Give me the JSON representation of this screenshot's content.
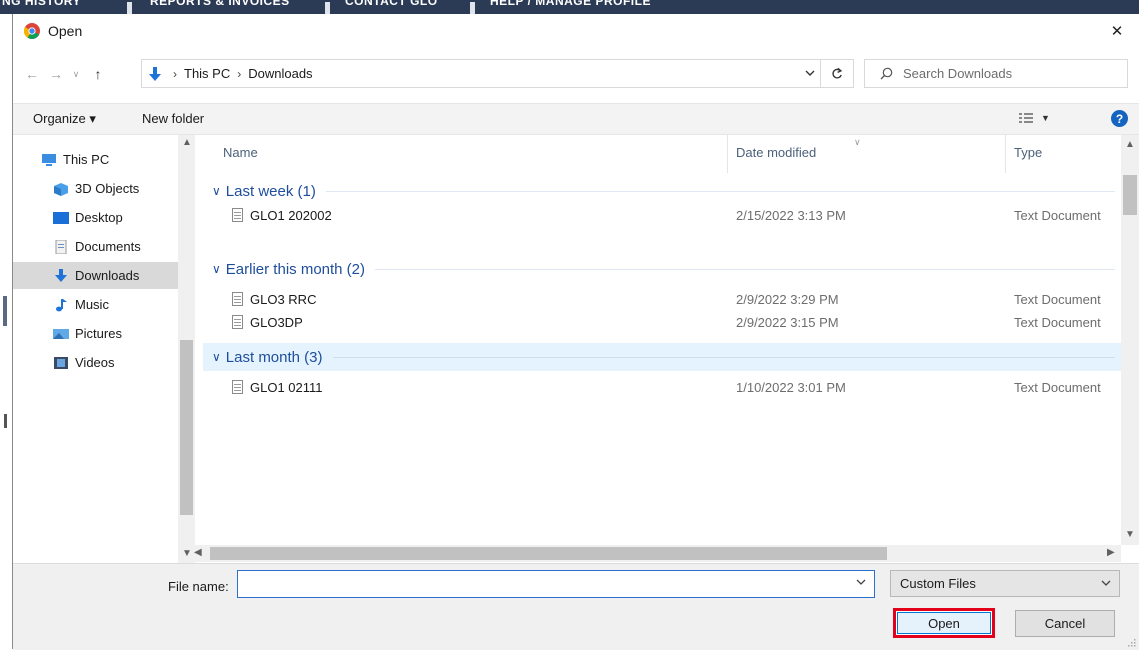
{
  "background_page": {
    "tabs": [
      "NG HISTORY",
      "REPORTS & INVOICES",
      "CONTACT GLO",
      "HELP / MANAGE PROFILE"
    ]
  },
  "window": {
    "title": "Open",
    "close_glyph": "✕"
  },
  "address": {
    "crumbs": [
      "This PC",
      "Downloads"
    ],
    "search_placeholder": "Search Downloads"
  },
  "toolbar": {
    "organize": "Organize ▾",
    "new_folder": "New folder",
    "help": "?"
  },
  "nav": {
    "items": [
      {
        "label": "This PC",
        "icon": "pc-icon"
      },
      {
        "label": "3D Objects",
        "icon": "cube-icon"
      },
      {
        "label": "Desktop",
        "icon": "desktop-icon"
      },
      {
        "label": "Documents",
        "icon": "documents-icon"
      },
      {
        "label": "Downloads",
        "icon": "download-icon",
        "selected": true
      },
      {
        "label": "Music",
        "icon": "music-icon"
      },
      {
        "label": "Pictures",
        "icon": "pictures-icon"
      },
      {
        "label": "Videos",
        "icon": "videos-icon"
      }
    ]
  },
  "columns": {
    "name": "Name",
    "date": "Date modified",
    "type": "Type"
  },
  "groups": [
    {
      "label": "Last week (1)",
      "files": [
        {
          "name": "GLO1 202002",
          "date": "2/15/2022 3:13 PM",
          "type": "Text Document"
        }
      ]
    },
    {
      "label": "Earlier this month (2)",
      "files": [
        {
          "name": "GLO3 RRC",
          "date": "2/9/2022 3:29 PM",
          "type": "Text Document"
        },
        {
          "name": "GLO3DP",
          "date": "2/9/2022 3:15 PM",
          "type": "Text Document"
        }
      ]
    },
    {
      "label": "Last month (3)",
      "highlighted": true,
      "files": [
        {
          "name": "GLO1 02111",
          "date": "1/10/2022 3:01 PM",
          "type": "Text Document"
        }
      ]
    }
  ],
  "footer": {
    "file_name_label": "File name:",
    "file_name_value": "",
    "filter": "Custom Files",
    "open": "Open",
    "cancel": "Cancel"
  },
  "colors": {
    "accent": "#0078d7",
    "highlight_border": "#e4001b",
    "group_text": "#1e4e9c"
  }
}
